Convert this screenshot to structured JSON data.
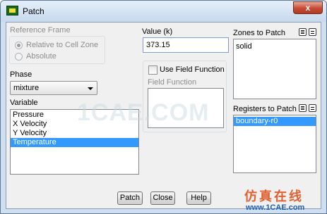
{
  "window": {
    "title": "Patch",
    "close_glyph": "x"
  },
  "reference_frame": {
    "legend": "Reference Frame",
    "options": [
      "Relative to Cell Zone",
      "Absolute"
    ],
    "selected": "Relative to Cell Zone"
  },
  "phase": {
    "label": "Phase",
    "value": "mixture"
  },
  "variable": {
    "label": "Variable",
    "items": [
      "Pressure",
      "X Velocity",
      "Y Velocity",
      "Temperature"
    ],
    "selected": "Temperature"
  },
  "value": {
    "label": "Value (k)",
    "text": "373.15"
  },
  "field_function": {
    "checkbox_label": "Use Field Function",
    "checked": false,
    "list_label": "Field Function"
  },
  "zones": {
    "label": "Zones to Patch",
    "items": [
      "solid"
    ]
  },
  "registers": {
    "label": "Registers to Patch",
    "items": [
      "boundary-r0"
    ],
    "selected": "boundary-r0"
  },
  "buttons": {
    "patch": "Patch",
    "close": "Close",
    "help": "Help"
  },
  "watermark": {
    "text": "1CAE.COM"
  },
  "branding": {
    "cn": "仿真在线",
    "url": "www.1CAE.com"
  },
  "colors": {
    "selection": "#3399ff",
    "client_bg": "#f0f0f0",
    "title_bg": "#cfdff0"
  }
}
